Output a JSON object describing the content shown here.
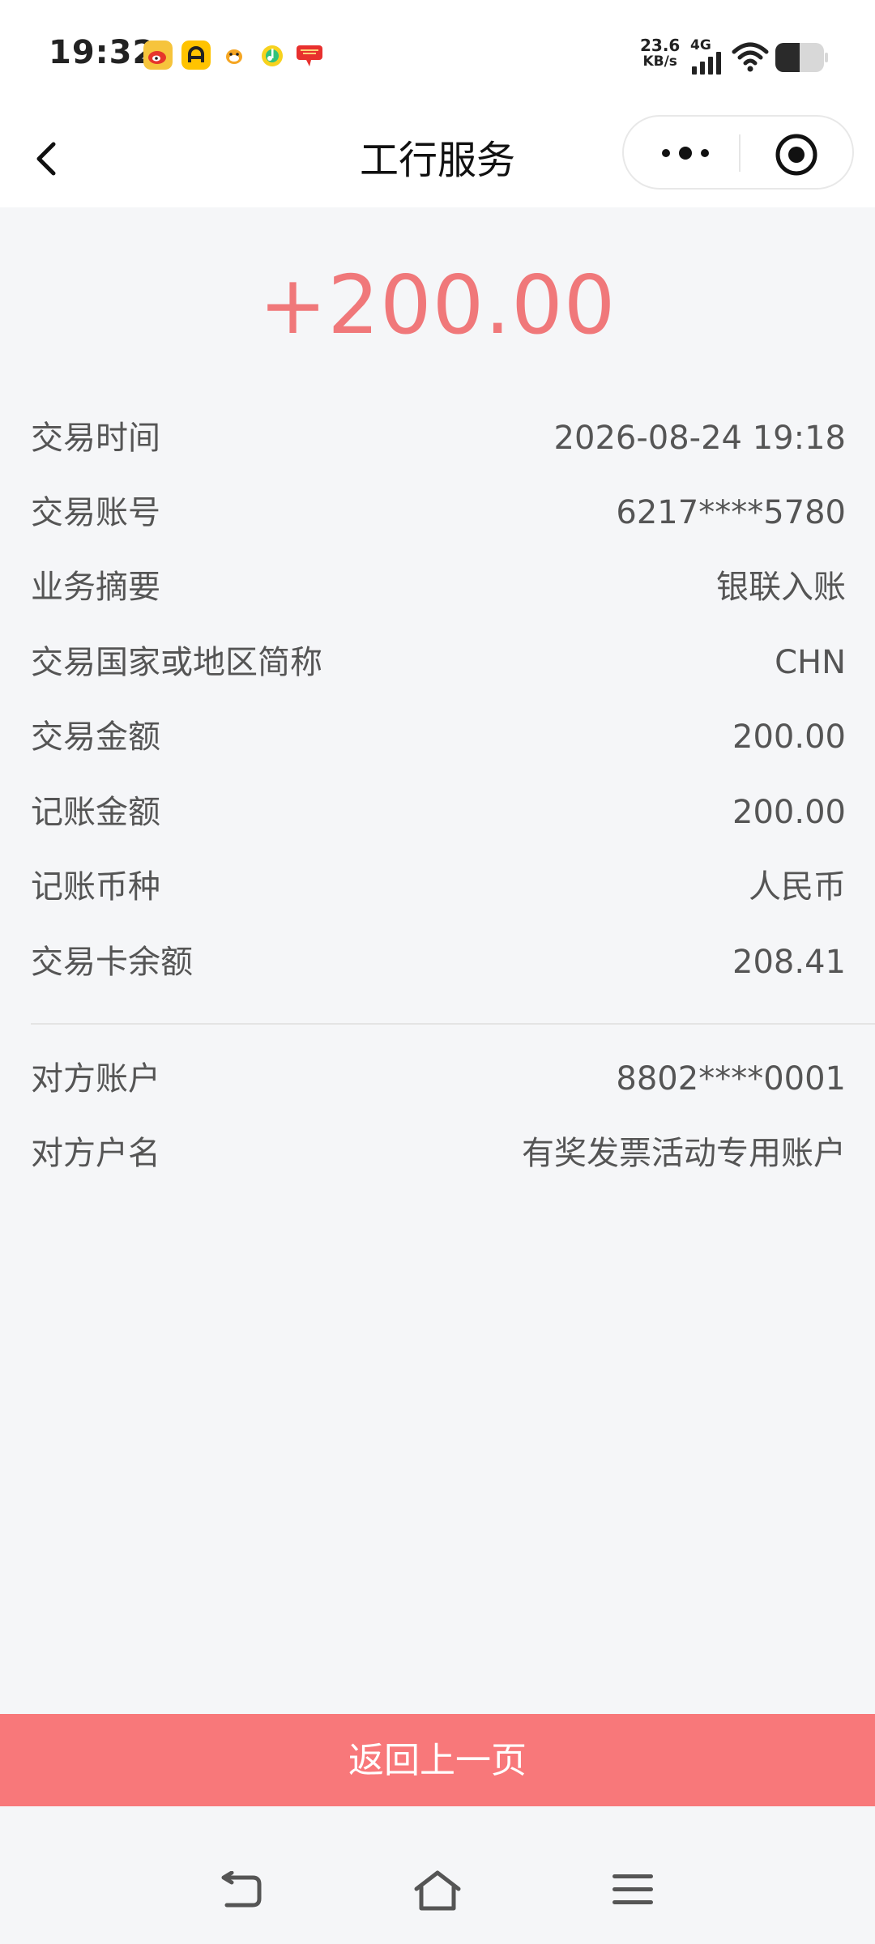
{
  "status_bar": {
    "time": "19:32",
    "net_speed_value": "23.6",
    "net_speed_unit": "KB/s",
    "network_type": "4G",
    "app_icons": [
      "weibo-icon",
      "meituan-icon",
      "qq-icon",
      "qq-music-icon",
      "red-envelope-icon"
    ]
  },
  "nav": {
    "title": "工行服务"
  },
  "transaction": {
    "amount": "+200.00",
    "details": [
      {
        "label": "交易时间",
        "value": "2026-08-24 19:18"
      },
      {
        "label": "交易账号",
        "value": "6217****5780"
      },
      {
        "label": "业务摘要",
        "value": "银联入账"
      },
      {
        "label": "交易国家或地区简称",
        "value": "CHN"
      },
      {
        "label": "交易金额",
        "value": "200.00"
      },
      {
        "label": "记账金额",
        "value": "200.00"
      },
      {
        "label": "记账币种",
        "value": "人民币"
      },
      {
        "label": "交易卡余额",
        "value": "208.41"
      }
    ],
    "counterparty": [
      {
        "label": "对方账户",
        "value": "8802****0001"
      },
      {
        "label": "对方户名",
        "value": "有奖发票活动专用账户"
      }
    ]
  },
  "footer": {
    "back_button_label": "返回上一页"
  },
  "colors": {
    "accent": "#f8787a",
    "amount": "#f0787a",
    "background": "#f5f6f8"
  }
}
